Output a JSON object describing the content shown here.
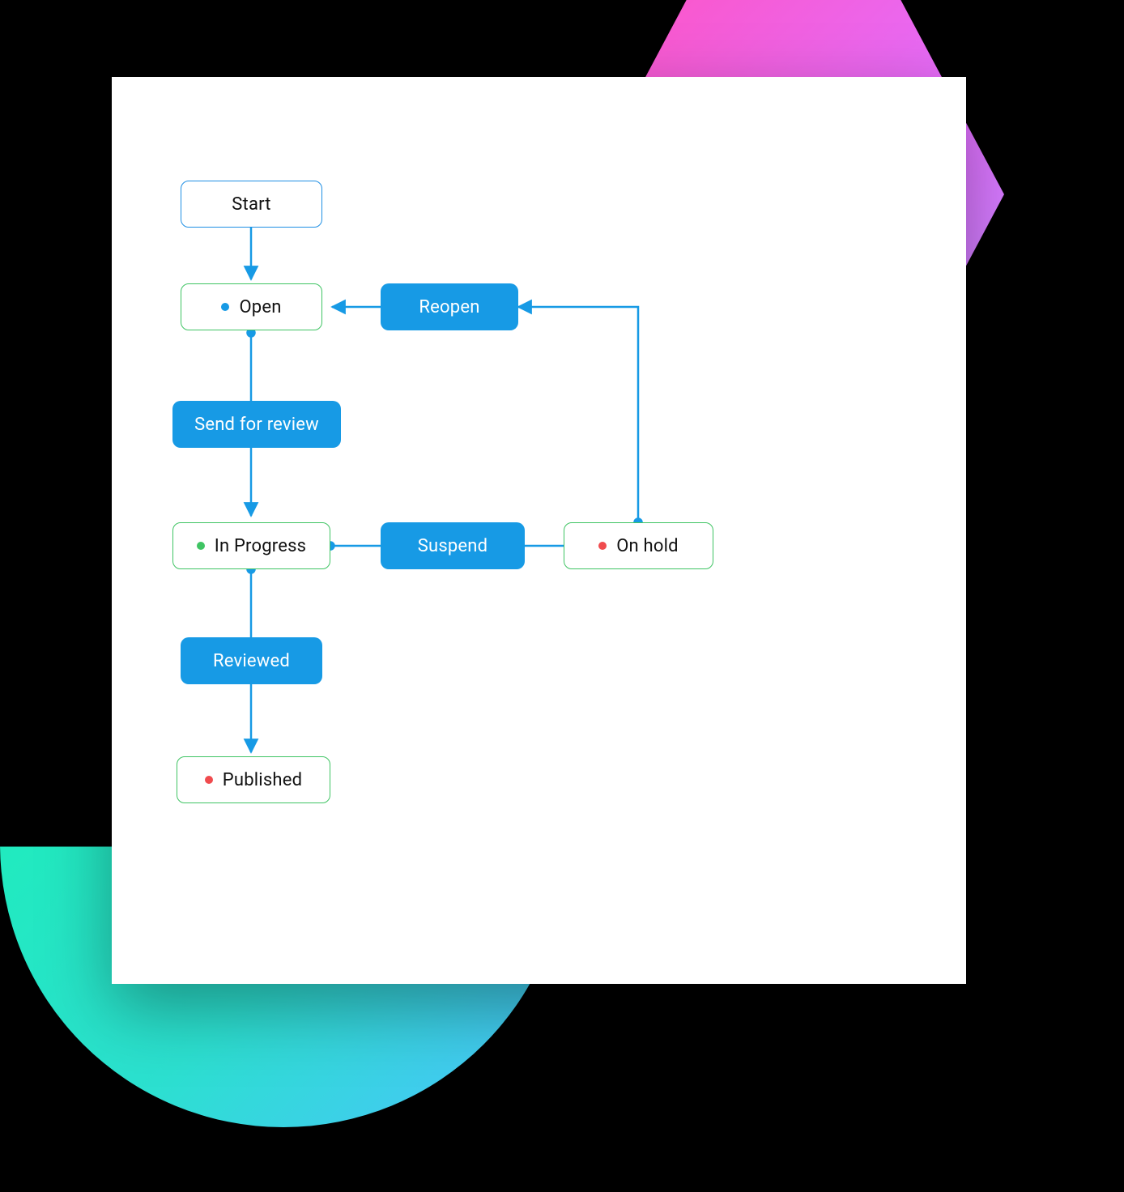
{
  "colors": {
    "accent": "#179ae5",
    "stateBorder": "#3fc463",
    "startBorder": "#1f8fe4",
    "dotBlue": "#179ae5",
    "dotGreen": "#3fc463",
    "dotRed": "#f04b4e"
  },
  "diagram": {
    "nodes": {
      "start": {
        "type": "start",
        "label": "Start"
      },
      "open": {
        "type": "state",
        "label": "Open",
        "dot": "blue"
      },
      "inProgress": {
        "type": "state",
        "label": "In Progress",
        "dot": "green"
      },
      "onHold": {
        "type": "state",
        "label": "On hold",
        "dot": "red"
      },
      "published": {
        "type": "state",
        "label": "Published",
        "dot": "red"
      },
      "reopen": {
        "type": "action",
        "label": "Reopen"
      },
      "sendReview": {
        "type": "action",
        "label": "Send for review"
      },
      "suspend": {
        "type": "action",
        "label": "Suspend"
      },
      "reviewed": {
        "type": "action",
        "label": "Reviewed"
      }
    },
    "edges": [
      {
        "from": "start",
        "to": "open"
      },
      {
        "from": "open",
        "to": "sendReview"
      },
      {
        "from": "sendReview",
        "to": "inProgress"
      },
      {
        "from": "inProgress",
        "to": "reviewed"
      },
      {
        "from": "reviewed",
        "to": "published"
      },
      {
        "from": "inProgress",
        "to": "suspend"
      },
      {
        "from": "suspend",
        "to": "onHold"
      },
      {
        "from": "onHold",
        "to": "reopen"
      },
      {
        "from": "reopen",
        "to": "open"
      }
    ]
  }
}
